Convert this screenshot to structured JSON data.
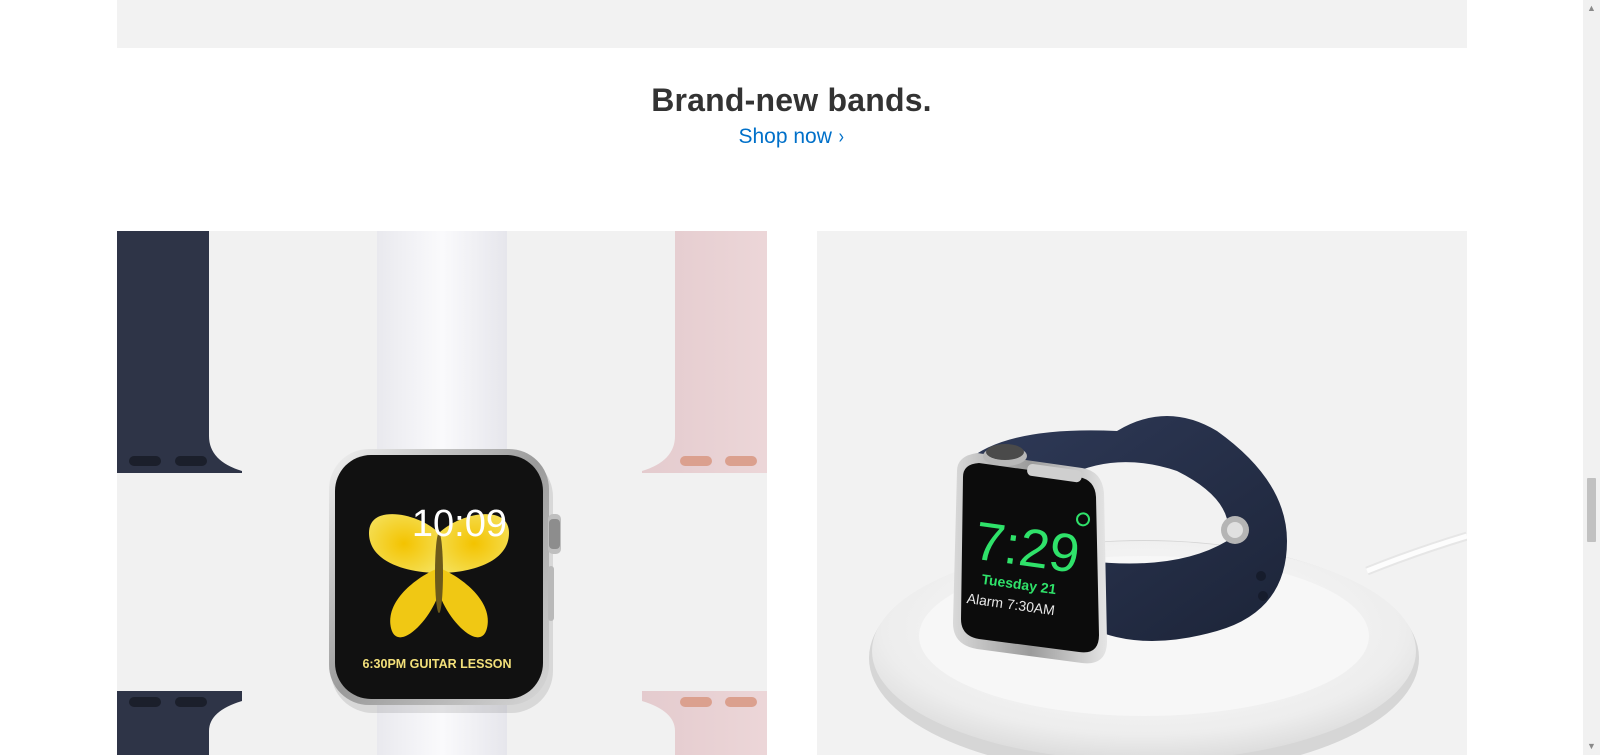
{
  "promo": {
    "title": "Brand-new bands.",
    "link_label": "Shop now",
    "link_chevron": "›"
  },
  "tiles": {
    "left": {
      "watch_time": "10:09",
      "watch_event": "6:30PM GUITAR LESSON"
    },
    "right": {
      "watch_time": "7:29",
      "watch_date": "Tuesday 21",
      "watch_alarm": "Alarm 7:30AM"
    }
  },
  "colors": {
    "link": "#0070c9",
    "heading": "#333333",
    "band_navy": "#2e3447",
    "band_white": "#f7f7f9",
    "band_pink": "#e7cfd2",
    "nightstand_green": "#2fe26a"
  },
  "scrollbar": {
    "up_icon": "triangle-up-icon",
    "down_icon": "triangle-down-icon"
  }
}
